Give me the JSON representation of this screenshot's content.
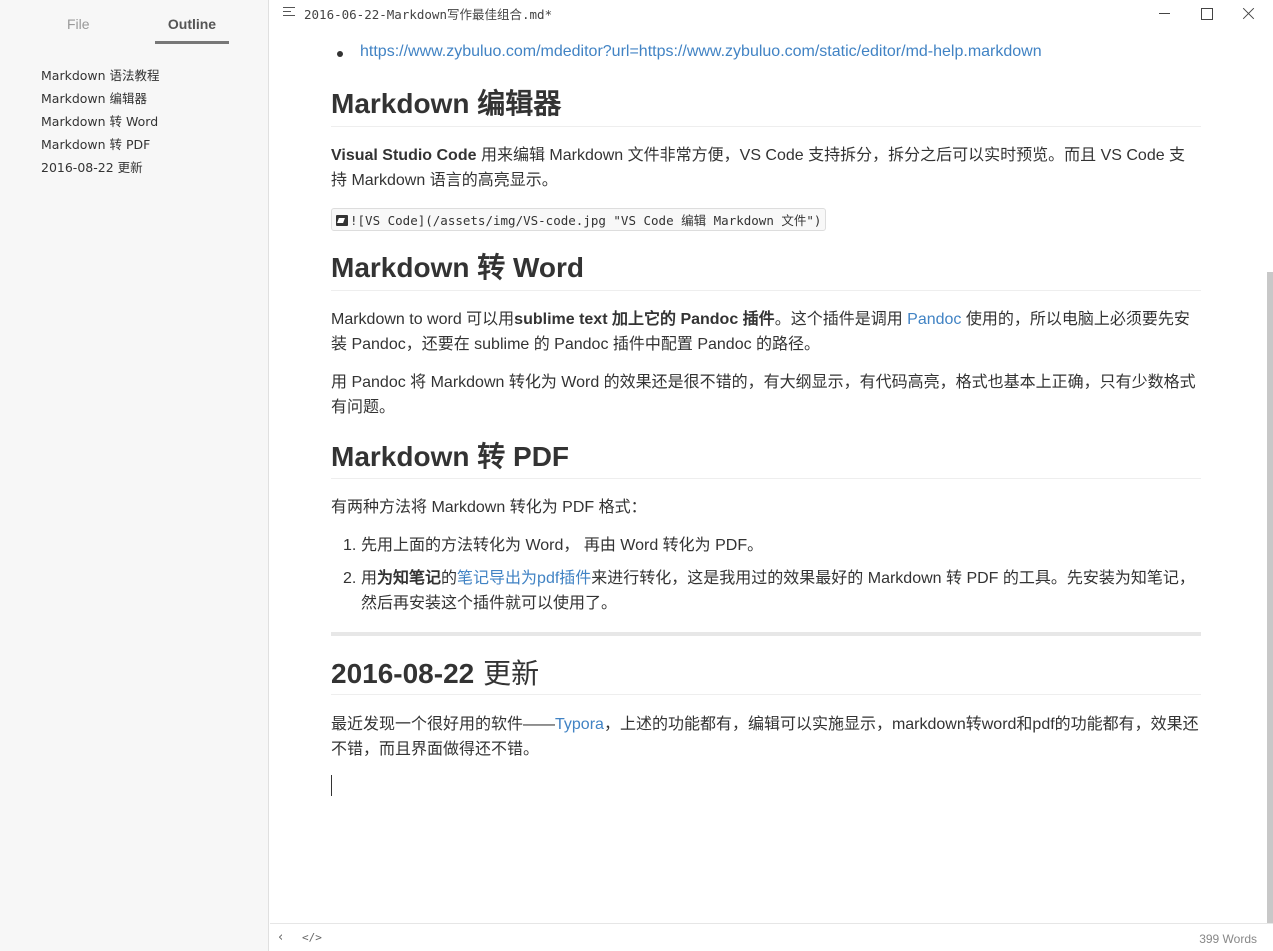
{
  "sidebar": {
    "tabs": {
      "file": "File",
      "outline": "Outline"
    },
    "outline_items": [
      "Markdown 语法教程",
      "Markdown 编辑器",
      "Markdown 转 Word",
      "Markdown 转 PDF",
      "2016-08-22 更新"
    ]
  },
  "titlebar": {
    "filename": "2016-06-22-Markdown写作最佳组合.md*"
  },
  "content": {
    "top_link": "https://www.zybuluo.com/mdeditor?url=https://www.zybuluo.com/static/editor/md-help.markdown",
    "editor_heading": "Markdown 编辑器",
    "editor_para_bold": "Visual Studio Code",
    "editor_para_rest": " 用来编辑 Markdown 文件非常方便，VS Code 支持拆分，拆分之后可以实时预览。而且 VS Code 支持 Markdown 语言的高亮显示。",
    "image_code": "![VS Code](/assets/img/VS-code.jpg \"VS Code 编辑  Markdown 文件\")",
    "word_heading": "Markdown 转 Word",
    "word_p1_a": "Markdown to word 可以用",
    "word_p1_b": "sublime text 加上它的 ",
    "word_p1_link1": "Pandoc 插件",
    "word_p1_c": "。这个插件是调用 ",
    "word_p1_link2": "Pandoc",
    "word_p1_d": " 使用的，所以电脑上必须要先安装 Pandoc，还要在 sublime 的 Pandoc 插件中配置 Pandoc 的路径。",
    "word_p2": "用 Pandoc 将 Markdown 转化为 Word 的效果还是很不错的，有大纲显示，有代码高亮，格式也基本上正确，只有少数格式有问题。",
    "pdf_heading": "Markdown 转 PDF",
    "pdf_intro": "有两种方法将 Markdown 转化为 PDF 格式：",
    "pdf_steps": {
      "n1": "1.",
      "s1": "先用上面的方法转化为 Word， 再由 Word 转化为 PDF。",
      "n2": "2.",
      "s2_a": "用",
      "s2_b": "为知笔记",
      "s2_c": "的",
      "s2_link": "笔记导出为pdf插件",
      "s2_d": "来进行转化，这是我用过的效果最好的 Markdown 转 PDF 的工具。先安装为知笔记，然后再安装这个插件就可以使用了。"
    },
    "update_heading_date": "2016-08-22",
    "update_heading_word": " 更新",
    "update_p_a": "最近发现一个很好用的软件——",
    "update_p_link": "Typora",
    "update_p_b": "，上述的功能都有，编辑可以实施显示，markdown转word和pdf的功能都有，效果还不错，而且界面做得还不错。"
  },
  "statusbar": {
    "back_glyph": "‹",
    "source_glyph": "</>",
    "word_count": "399 Words"
  },
  "colors": {
    "link": "#4183c4",
    "sidebar_bg": "#f7f7f7",
    "text": "#333333"
  },
  "icons": [
    "menu-icon",
    "minimize-icon",
    "maximize-icon",
    "close-icon",
    "image-icon",
    "back-icon",
    "source-code-icon"
  ]
}
